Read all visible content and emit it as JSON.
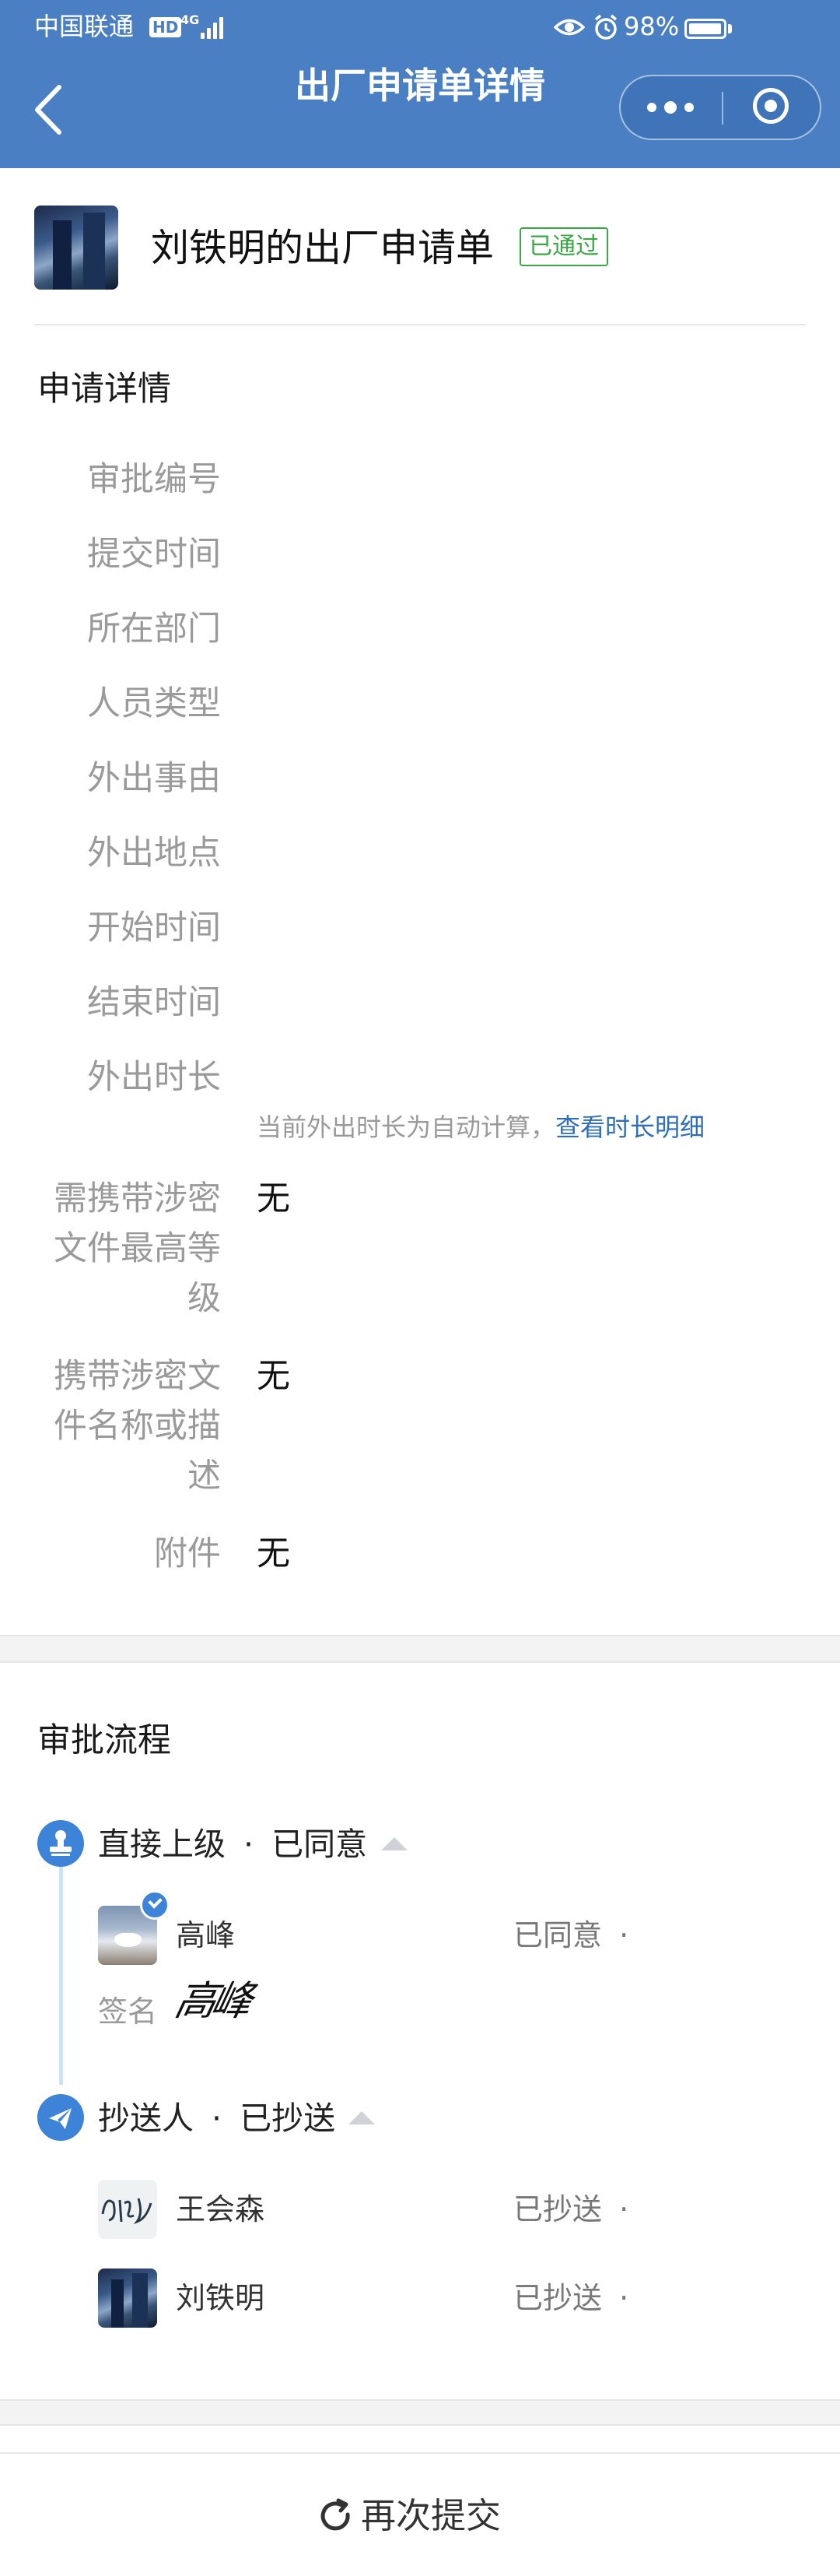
{
  "status_bar": {
    "carrier": "中国联通",
    "hd": "HD",
    "network": "4G",
    "battery": "98%"
  },
  "nav": {
    "title": "出厂申请单详情"
  },
  "colors": {
    "header_blue": "#4a7fc4",
    "approved_green": "#3aa745",
    "link_blue": "#2f6fba",
    "flow_blue": "#3d84d8"
  },
  "application": {
    "title": "刘铁明的出厂申请单",
    "status": "已通过"
  },
  "details": {
    "section_title": "申请详情",
    "labels": [
      "审批编号",
      "提交时间",
      "所在部门",
      "人员类型",
      "外出事由",
      "外出地点",
      "开始时间",
      "结束时间",
      "外出时长"
    ],
    "duration_note": "当前外出时长为自动计算，",
    "duration_link": "查看时长明细",
    "secret_level": {
      "label_lines": [
        "需携带涉密",
        "文件最高等",
        "级"
      ],
      "value": "无"
    },
    "secret_desc": {
      "label_lines": [
        "携带涉密文",
        "件名称或描",
        "述"
      ],
      "value": "无"
    },
    "attachment": {
      "label": "附件",
      "value": "无"
    }
  },
  "flow": {
    "section_title": "审批流程",
    "nodes": [
      {
        "title": "直接上级",
        "sep": "·",
        "state": "已同意",
        "icon": "stamp-icon",
        "people": [
          {
            "name": "高峰",
            "status": "已同意",
            "dot": "·",
            "avatar": "teacup-photo"
          }
        ],
        "signature_label": "签名",
        "signature_text": "高峰"
      },
      {
        "title": "抄送人",
        "sep": "·",
        "state": "已抄送",
        "icon": "send-icon",
        "people": [
          {
            "name": "王会森",
            "status": "已抄送",
            "dot": "·",
            "avatar": "signature-photo"
          },
          {
            "name": "刘铁明",
            "status": "已抄送",
            "dot": "·",
            "avatar": "city-photo"
          }
        ]
      }
    ]
  },
  "footer": {
    "resubmit": "再次提交"
  }
}
